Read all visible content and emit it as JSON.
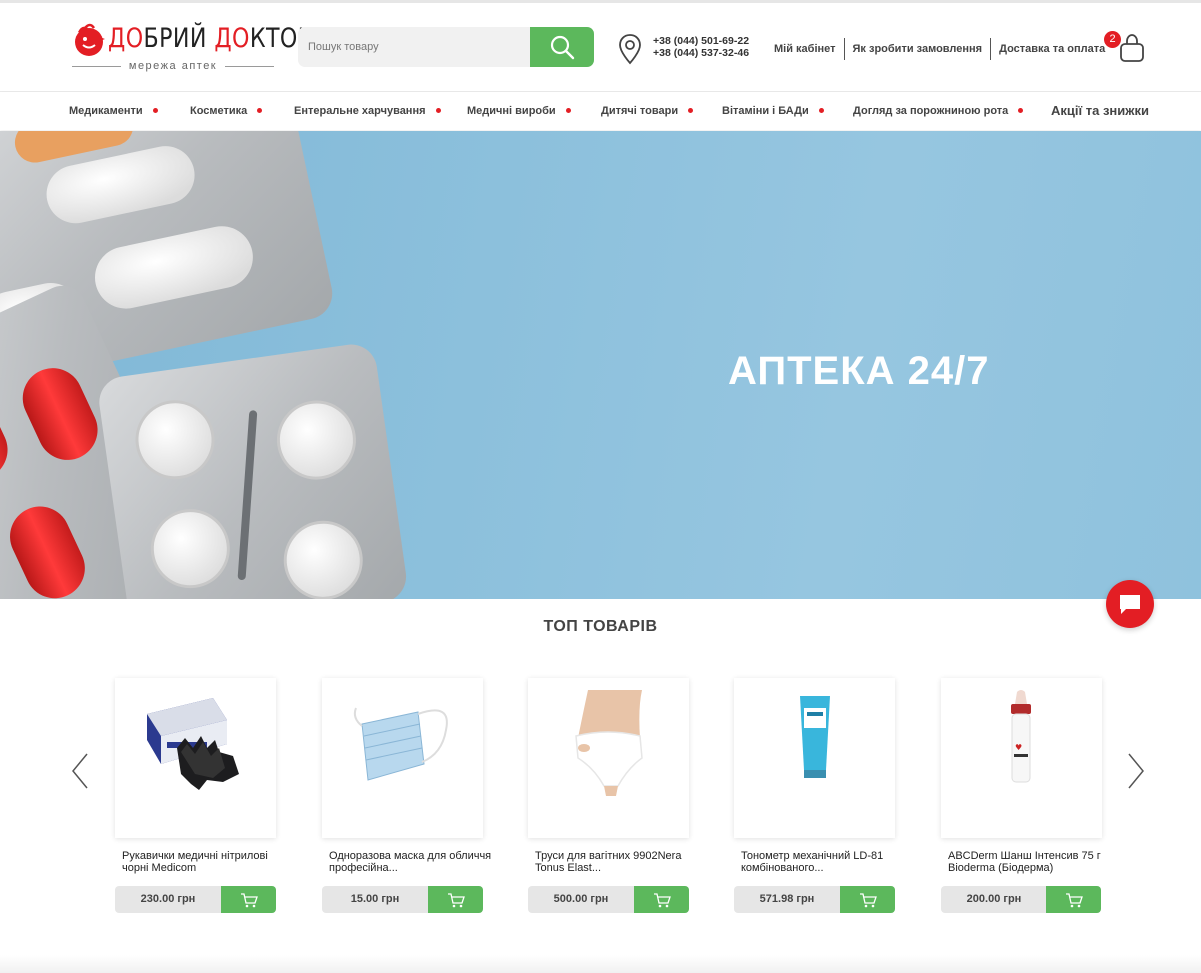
{
  "header": {
    "logo": {
      "name_red_1": "ДО",
      "name_dark_1": "БРИЙ ",
      "name_red_2": "ДО",
      "name_dark_2": "КТОР",
      "tagline": "мережа аптек"
    },
    "search": {
      "placeholder": "Пошук товару"
    },
    "phones": [
      "+38 (044) 501-69-22",
      "+38 (044) 537-32-46"
    ],
    "links": [
      "Мій кабінет",
      "Як зробити замовлення",
      "Доставка та оплата"
    ],
    "cart_count": "2"
  },
  "menu": {
    "items": [
      "Медикаменти",
      "Косметика",
      "Ентеральне харчування",
      "Медичні вироби",
      "Дитячі товари",
      "Вітаміни і БАДи",
      "Догляд за порожниною рота"
    ],
    "promo": "Акції та знижки"
  },
  "hero": {
    "title": "АПТЕКА 24/7"
  },
  "top": {
    "title": "ТОП ТОВАРІВ",
    "products": [
      {
        "name": "Рукавички медичні нітрилові чорні Medicom",
        "price": "230.00 грн"
      },
      {
        "name": "Одноразова маска для обличчя професійна...",
        "price": "15.00 грн"
      },
      {
        "name": "Труси для вагітних 9902Nera Tonus Elast...",
        "price": "500.00 грн"
      },
      {
        "name": "Тонометр механічний LD-81 комбінованого...",
        "price": "571.98 грн"
      },
      {
        "name": "ABCDerm Шанш Інтенсив 75 г Bioderma (Біодерма)",
        "price": "200.00 грн"
      }
    ]
  },
  "colors": {
    "brand_red": "#e31e24",
    "accent_green": "#5cb85c"
  }
}
